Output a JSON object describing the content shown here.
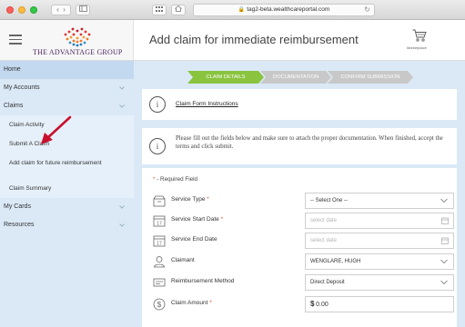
{
  "browser": {
    "url": "tag2-beta.wealthcareportal.com"
  },
  "brand": {
    "logo_text": "THE ADVANTAGE GROUP",
    "accent": "#4a2460",
    "logo_colors": [
      "#e3352f",
      "#f27a28",
      "#2a7ab8"
    ]
  },
  "header": {
    "title": "Add claim for immediate reimbursement",
    "marketplace_label": "Marketplace"
  },
  "sidebar": {
    "items": [
      {
        "label": "Home",
        "expandable": false
      },
      {
        "label": "My Accounts",
        "expandable": true
      },
      {
        "label": "Claims",
        "expandable": true
      },
      {
        "label": "Claim Activity",
        "sub": true
      },
      {
        "label": "Submit A Claim",
        "sub": true
      },
      {
        "label": "Add claim for future reimbursement",
        "sub": true
      },
      {
        "label": "Claim Summary",
        "sub": true
      },
      {
        "label": "My Cards",
        "expandable": true
      },
      {
        "label": "Resources",
        "expandable": true
      }
    ]
  },
  "steps": [
    {
      "label": "CLAIM DETAILS",
      "active": true
    },
    {
      "label": "DOCUMENTATION",
      "active": false
    },
    {
      "label": "CONFIRM SUBMISSION",
      "active": false
    }
  ],
  "instructions_link": "Claim Form Instructions",
  "note": "Please fill out the fields below and make sure to attach the proper documentation. When finished, accept the terms and click submit.",
  "required_note": "- Required Field",
  "required_star": "*",
  "form": {
    "service_type": {
      "label": "Service Type",
      "value": "-- Select One --"
    },
    "service_start_date": {
      "label": "Service Start Date",
      "placeholder": "select date"
    },
    "service_end_date": {
      "label": "Service End Date",
      "placeholder": "select date"
    },
    "claimant": {
      "label": "Claimant",
      "value": "WENGLARE, HUGH"
    },
    "reimbursement_method": {
      "label": "Reimbursement Method",
      "value": "Direct Deposit"
    },
    "claim_amount": {
      "label": "Claim Amount",
      "currency": "$",
      "value": "0.00"
    }
  },
  "colors": {
    "sidebar_bg": "#dbe9f6",
    "step_active": "#8ac43f",
    "step_inactive": "#c8c8c8",
    "required_star": "#e05a2b",
    "arrow": "#c8102e"
  }
}
